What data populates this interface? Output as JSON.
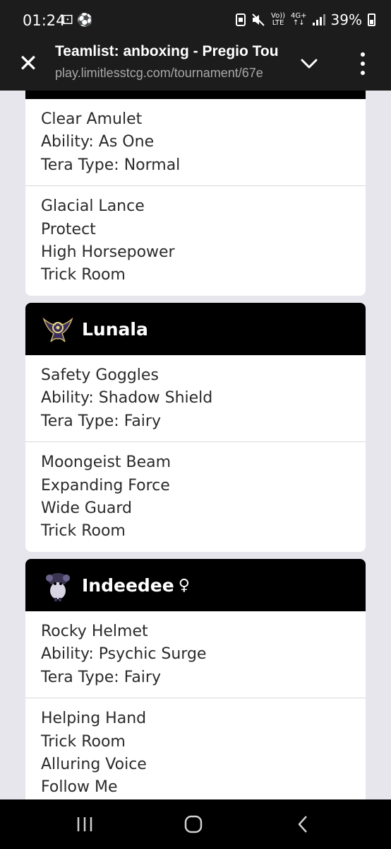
{
  "status_bar": {
    "time": "01:24",
    "left_icons": "⚀ ⚽",
    "volte_top": "Vo))",
    "volte_bottom": "LTE",
    "network_top": "4G+",
    "network_bottom": "↑↓",
    "battery": "39%"
  },
  "toolbar": {
    "close_glyph": "✕",
    "title": "Teamlist: anboxing - Pregio Tou",
    "url": "play.limitlesstcg.com/tournament/67e"
  },
  "cards": [
    {
      "item_section": [
        "Clear Amulet",
        "Ability: As One",
        "Tera Type: Normal"
      ],
      "moves": [
        "Glacial Lance",
        "Protect",
        "High Horsepower",
        "Trick Room"
      ]
    },
    {
      "name": "Lunala",
      "item_section": [
        "Safety Goggles",
        "Ability: Shadow Shield",
        "Tera Type: Fairy"
      ],
      "moves": [
        "Moongeist Beam",
        "Expanding Force",
        "Wide Guard",
        "Trick Room"
      ]
    },
    {
      "name": "Indeedee",
      "gender": "♀",
      "item_section": [
        "Rocky Helmet",
        "Ability: Psychic Surge",
        "Tera Type: Fairy"
      ],
      "moves": [
        "Helping Hand",
        "Trick Room",
        "Alluring Voice",
        "Follow Me"
      ]
    }
  ],
  "colors": {
    "background": "#e6e6ec",
    "card_header": "#000000",
    "toolbar": "#1c1c1c"
  }
}
